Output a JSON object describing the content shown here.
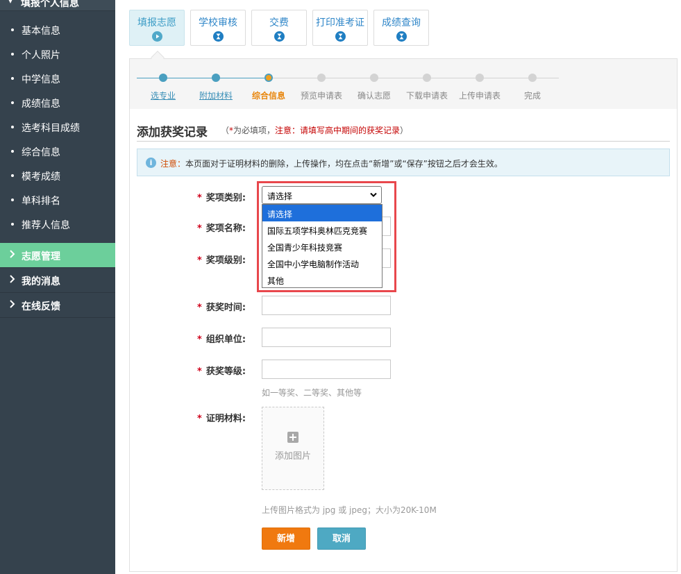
{
  "sidebar": {
    "top_label": "填报个人信息",
    "sub_items": [
      {
        "label": "基本信息"
      },
      {
        "label": "个人照片"
      },
      {
        "label": "中学信息"
      },
      {
        "label": "成绩信息"
      },
      {
        "label": "选考科目成绩"
      },
      {
        "label": "综合信息"
      },
      {
        "label": "模考成绩"
      },
      {
        "label": "单科排名"
      },
      {
        "label": "推荐人信息"
      }
    ],
    "nav_items": [
      {
        "label": "志愿管理",
        "active": true
      },
      {
        "label": "我的消息",
        "active": false
      },
      {
        "label": "在线反馈",
        "active": false
      }
    ]
  },
  "tabs": [
    {
      "label": "填报志愿",
      "icon": "play-icon",
      "active": true
    },
    {
      "label": "学校审核",
      "icon": "hourglass-icon",
      "active": false
    },
    {
      "label": "交费",
      "icon": "hourglass-icon",
      "active": false
    },
    {
      "label": "打印准考证",
      "icon": "hourglass-icon",
      "active": false
    },
    {
      "label": "成绩查询",
      "icon": "hourglass-icon",
      "active": false
    }
  ],
  "steps": [
    {
      "label": "选专业",
      "state": "done"
    },
    {
      "label": "附加材料",
      "state": "done"
    },
    {
      "label": "综合信息",
      "state": "current"
    },
    {
      "label": "预览申请表",
      "state": "pending"
    },
    {
      "label": "确认志愿",
      "state": "pending"
    },
    {
      "label": "下载申请表",
      "state": "pending"
    },
    {
      "label": "上传申请表",
      "state": "pending"
    },
    {
      "label": "完成",
      "state": "pending"
    }
  ],
  "section": {
    "title": "添加获奖记录",
    "note_open": "（",
    "note_star": "*",
    "note_required": "为必填项，",
    "note_warning": "注意：请填写高中期间的获奖记录",
    "note_close": "）"
  },
  "notice": {
    "prefix": "注意：",
    "text": "本页面对于证明材料的删除，上传操作，均在点击“新增”或“保存”按钮之后才会生效。"
  },
  "form": {
    "required_mark": "*",
    "award_category_label": "奖项类别:",
    "award_category_value": "请选择",
    "award_category_options": [
      "请选择",
      "国际五项学科奥林匹克竞赛",
      "全国青少年科技竞赛",
      "全国中小学电脑制作活动",
      "其他"
    ],
    "award_name_label": "奖项名称:",
    "award_name_value": "",
    "award_level_label": "奖项级别:",
    "award_level_value": "",
    "award_time_label": "获奖时间:",
    "award_time_value": "",
    "organizer_label": "组织单位:",
    "organizer_value": "",
    "award_grade_label": "获奖等级:",
    "award_grade_value": "",
    "award_grade_hint": "如一等奖、二等奖、其他等",
    "proof_label": "证明材料:",
    "upload_text": "添加图片",
    "upload_hint": "上传图片格式为 jpg 或 jpeg；大小为20K-10M"
  },
  "buttons": {
    "add": "新增",
    "cancel": "取消"
  },
  "colors": {
    "sidebar_bg": "#35424d",
    "sidebar_active": "#6ccf9b",
    "step_done": "#4a9fc0",
    "step_current": "#f0a020",
    "step_pending": "#d3d3d3",
    "add_button": "#f0790f",
    "cancel_button": "#4ea9c3",
    "highlight_box": "#e8474c"
  }
}
